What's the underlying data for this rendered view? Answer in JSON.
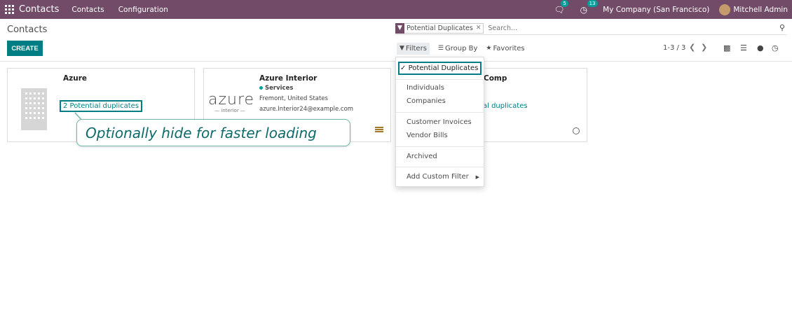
{
  "navbar": {
    "brand": "Contacts",
    "menus": [
      "Contacts",
      "Configuration"
    ],
    "messages_count": "5",
    "activities_count": "13",
    "company": "My Company (San Francisco)",
    "user": "Mitchell Admin"
  },
  "control_panel": {
    "breadcrumb": "Contacts",
    "create_label": "CREATE",
    "search": {
      "facet": "Potential Duplicates",
      "placeholder": "Search..."
    },
    "tabs": {
      "filters": "Filters",
      "group_by": "Group By",
      "favorites": "Favorites"
    },
    "pager": "1-3 / 3"
  },
  "filters_menu": {
    "items": [
      "Potential Duplicates",
      "Individuals",
      "Companies",
      "Customer Invoices",
      "Vendor Bills",
      "Archived",
      "Add Custom Filter"
    ]
  },
  "cards": [
    {
      "name": "Azure",
      "duplicates": "2 Potential duplicates"
    },
    {
      "name": "Azure Interior",
      "tag": "Services",
      "location": "Fremont, United States",
      "email": "azure.Interior24@example.com",
      "logo_word": "azure",
      "logo_sub": "interior"
    },
    {
      "name_fragment": "Comp",
      "duplicates_fragment": "al duplicates"
    }
  ],
  "annotation": {
    "text": "Optionally hide for faster loading"
  },
  "colors": {
    "navbar": "#714b67",
    "primary": "#017e84",
    "highlight": "#017e84"
  }
}
